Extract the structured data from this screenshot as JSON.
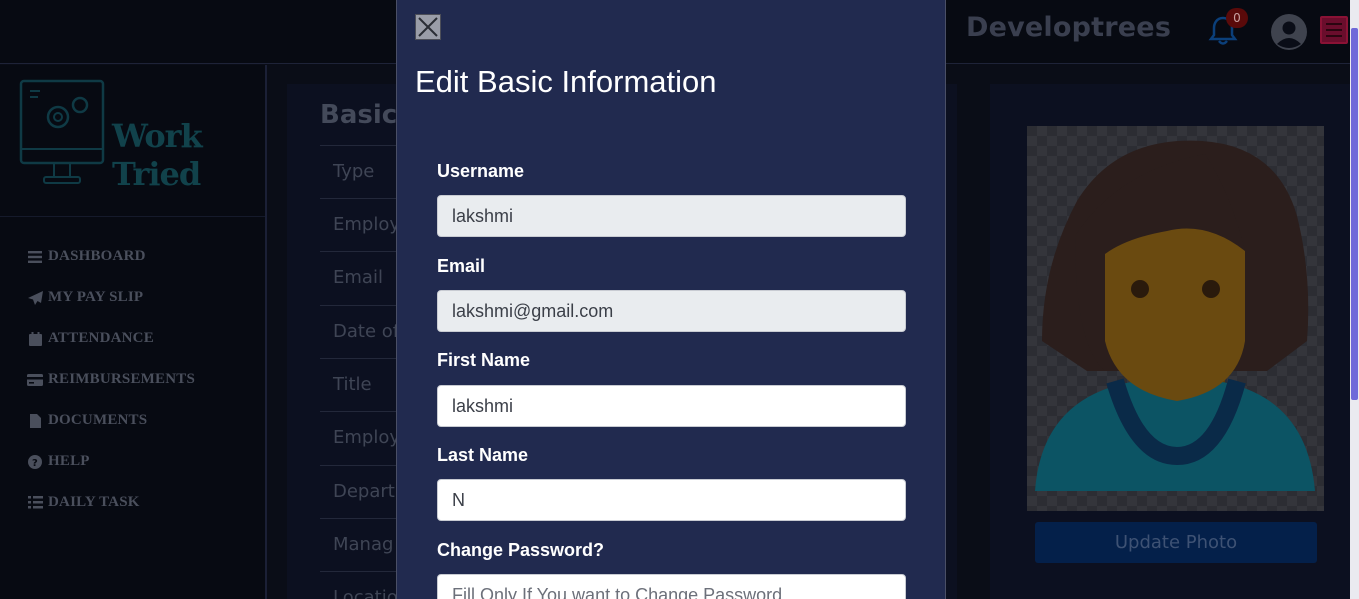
{
  "header": {
    "brand": "Developtrees",
    "notification_count": "0"
  },
  "sidebar": {
    "logo_text": "Work Tried",
    "items": [
      {
        "label": "DASHBOARD",
        "icon": "bars-icon"
      },
      {
        "label": "MY PAY SLIP",
        "icon": "paper-plane-icon"
      },
      {
        "label": "ATTENDANCE",
        "icon": "calendar-icon"
      },
      {
        "label": "REIMBURSEMENTS",
        "icon": "credit-card-icon"
      },
      {
        "label": "DOCUMENTS",
        "icon": "file-icon"
      },
      {
        "label": "HELP",
        "icon": "question-circle-icon"
      },
      {
        "label": "DAILY TASK",
        "icon": "list-icon"
      }
    ]
  },
  "main": {
    "title": "Basic",
    "rows": [
      "Type",
      "Employ",
      "Email",
      "Date of",
      "Title",
      "Employ",
      "Depart",
      "Manag",
      "Locatio"
    ]
  },
  "photo_panel": {
    "update_label": "Update Photo"
  },
  "modal": {
    "title": "Edit Basic Information",
    "fields": {
      "username": {
        "label": "Username",
        "value": "lakshmi"
      },
      "email": {
        "label": "Email",
        "value": "lakshmi@gmail.com"
      },
      "first_name": {
        "label": "First Name",
        "value": "lakshmi"
      },
      "last_name": {
        "label": "Last Name",
        "value": "N"
      },
      "password": {
        "label": "Change Password?",
        "placeholder": "Fill Only If You want to Change Password"
      }
    }
  },
  "colors": {
    "modal_bg": "#212a4f",
    "page_bg": "#0a0d17",
    "update_button": "#04204a",
    "menu_button": "#6a0d2c"
  }
}
